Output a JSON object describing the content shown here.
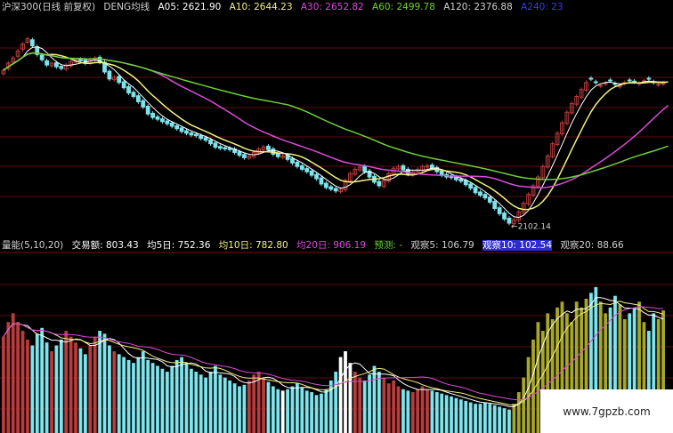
{
  "colors": {
    "background": "#000000",
    "grid": "#7a1010",
    "up": "#b83c3c",
    "down": "#7fe3ec",
    "ma5": "#ffffff",
    "ma10": "#f4f080",
    "ma30": "#d84cd8",
    "ma60": "#6ecf3a",
    "ma120": "#ffffff",
    "ma240": "#3a3aff",
    "vol_up_early": "#ffffff",
    "vol_up_late": "#a6a62a",
    "label_gray": "#d0d0d0",
    "label_yellow": "#f0e060"
  },
  "header": {
    "title": "沪深300(日线 前复权)",
    "indicator": "DENG均线",
    "ma05": "A05: 2621.90",
    "ma10": "A10: 2644.23",
    "ma30": "A30: 2652.82",
    "ma60": "A60: 2499.78",
    "ma120": "A120: 2376.88",
    "ma240": "A240: 23"
  },
  "volume_header": {
    "title": "量能(5,10,20)",
    "amount": "交易额: 803.43",
    "avg5": "均5日: 752.36",
    "avg10": "均10日: 782.80",
    "avg20": "均20日: 906.19",
    "forecast": "预测: -",
    "obs5": "观察5: 106.79",
    "obs10": "观察10: 102.54",
    "obs20": "观察20: 88.66"
  },
  "annotation": {
    "low_label": "←2102.14"
  },
  "watermark": "www.7gpzb.com",
  "chart_data": [
    {
      "type": "candlestick",
      "title": "沪深300(日线 前复权)",
      "y_unit": "index points",
      "ylim": [
        2080,
        2700
      ],
      "low_marker": 2102.14,
      "series": [
        {
          "name": "A05",
          "last": 2621.9
        },
        {
          "name": "A10",
          "last": 2644.23
        },
        {
          "name": "A30",
          "last": 2652.82
        },
        {
          "name": "A60",
          "last": 2499.78
        },
        {
          "name": "A120",
          "last": 2376.88
        }
      ],
      "close": [
        2545,
        2565,
        2580,
        2600,
        2620,
        2635,
        2615,
        2590,
        2575,
        2560,
        2565,
        2555,
        2550,
        2560,
        2570,
        2575,
        2572,
        2565,
        2575,
        2580,
        2568,
        2540,
        2520,
        2525,
        2510,
        2495,
        2480,
        2470,
        2455,
        2440,
        2420,
        2410,
        2405,
        2398,
        2392,
        2385,
        2378,
        2370,
        2365,
        2360,
        2358,
        2350,
        2345,
        2335,
        2325,
        2322,
        2320,
        2318,
        2310,
        2302,
        2295,
        2300,
        2310,
        2320,
        2326,
        2318,
        2305,
        2298,
        2300,
        2290,
        2280,
        2270,
        2262,
        2255,
        2245,
        2235,
        2220,
        2210,
        2205,
        2200,
        2205,
        2230,
        2250,
        2262,
        2268,
        2255,
        2240,
        2225,
        2215,
        2230,
        2250,
        2265,
        2270,
        2260,
        2248,
        2255,
        2262,
        2270,
        2272,
        2265,
        2255,
        2245,
        2240,
        2238,
        2232,
        2228,
        2218,
        2208,
        2195,
        2188,
        2180,
        2168,
        2150,
        2135,
        2120,
        2108,
        2118,
        2140,
        2165,
        2190,
        2215,
        2240,
        2270,
        2300,
        2335,
        2365,
        2395,
        2425,
        2450,
        2470,
        2490,
        2510,
        2520,
        2510,
        2502,
        2508,
        2515,
        2505,
        2500,
        2510,
        2515,
        2512,
        2508,
        2515,
        2520,
        2510,
        2505,
        2508,
        2512
      ],
      "open": [
        2535,
        2550,
        2568,
        2585,
        2605,
        2625,
        2632,
        2612,
        2588,
        2572,
        2558,
        2566,
        2556,
        2548,
        2558,
        2568,
        2576,
        2574,
        2566,
        2574,
        2582,
        2568,
        2542,
        2518,
        2527,
        2512,
        2498,
        2482,
        2472,
        2458,
        2442,
        2422,
        2412,
        2406,
        2400,
        2394,
        2386,
        2380,
        2372,
        2366,
        2362,
        2358,
        2352,
        2346,
        2337,
        2327,
        2324,
        2322,
        2320,
        2312,
        2304,
        2294,
        2298,
        2308,
        2318,
        2328,
        2320,
        2307,
        2296,
        2302,
        2292,
        2282,
        2272,
        2264,
        2257,
        2247,
        2237,
        2222,
        2212,
        2207,
        2198,
        2203,
        2228,
        2248,
        2260,
        2270,
        2257,
        2242,
        2227,
        2213,
        2228,
        2248,
        2263,
        2272,
        2262,
        2246,
        2253,
        2260,
        2268,
        2274,
        2267,
        2257,
        2247,
        2242,
        2240,
        2234,
        2230,
        2220,
        2210,
        2197,
        2190,
        2182,
        2170,
        2152,
        2137,
        2122,
        2106,
        2116,
        2138,
        2163,
        2188,
        2213,
        2238,
        2268,
        2298,
        2333,
        2363,
        2393,
        2423,
        2448,
        2468,
        2488,
        2522,
        2512,
        2500,
        2506,
        2517,
        2507,
        2498,
        2508,
        2517,
        2514,
        2506,
        2513,
        2522,
        2512,
        2503,
        2506
      ]
    },
    {
      "type": "bar",
      "title": "量能(5,10,20)",
      "y_unit": "trade amount",
      "ylim": [
        0,
        1200
      ],
      "series": [
        {
          "name": "交易额",
          "last": 803.43
        },
        {
          "name": "均5日",
          "last": 752.36
        },
        {
          "name": "均10日",
          "last": 782.8
        },
        {
          "name": "均20日",
          "last": 906.19
        }
      ],
      "values": [
        660,
        760,
        820,
        760,
        700,
        640,
        600,
        680,
        720,
        620,
        560,
        600,
        640,
        700,
        660,
        620,
        580,
        540,
        600,
        660,
        700,
        680,
        600,
        560,
        540,
        520,
        500,
        480,
        520,
        560,
        500,
        480,
        460,
        440,
        420,
        460,
        500,
        520,
        480,
        440,
        420,
        400,
        380,
        420,
        460,
        400,
        380,
        360,
        340,
        320,
        330,
        360,
        400,
        420,
        380,
        350,
        320,
        300,
        290,
        300,
        320,
        340,
        310,
        290,
        280,
        260,
        270,
        300,
        360,
        420,
        520,
        560,
        480,
        420,
        380,
        360,
        400,
        460,
        420,
        380,
        340,
        360,
        320,
        300,
        290,
        280,
        300,
        320,
        300,
        290,
        280,
        270,
        260,
        250,
        240,
        230,
        220,
        210,
        200,
        200,
        210,
        200,
        190,
        180,
        170,
        160,
        200,
        280,
        380,
        520,
        640,
        760,
        700,
        820,
        780,
        860,
        900,
        820,
        760,
        900,
        860,
        920,
        960,
        1000,
        900,
        820,
        860,
        940,
        880,
        780,
        820,
        860,
        900,
        760,
        700,
        820,
        780,
        840
      ]
    }
  ]
}
